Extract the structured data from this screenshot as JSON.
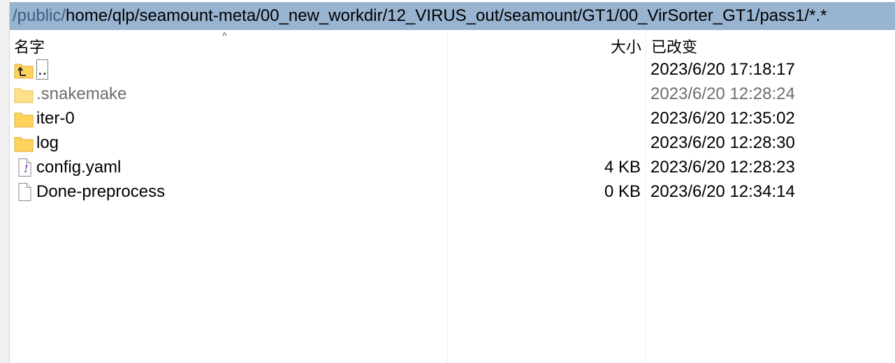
{
  "path_bar": {
    "prefix": "/public/",
    "rest": "home/qlp/seamount-meta/00_new_workdir/12_VIRUS_out/seamount/GT1/00_VirSorter_GT1/pass1/*.*"
  },
  "columns": {
    "name": "名字",
    "size": "大小",
    "date": "已改变"
  },
  "sort": {
    "column": "name",
    "arrow": "^"
  },
  "files": [
    {
      "icon": "parent-folder-icon",
      "name": "..",
      "size": "",
      "date": "2023/6/20 17:18:17",
      "hidden": false
    },
    {
      "icon": "folder-icon",
      "name": ".snakemake",
      "size": "",
      "date": "2023/6/20 12:28:24",
      "hidden": true
    },
    {
      "icon": "folder-icon",
      "name": "iter-0",
      "size": "",
      "date": "2023/6/20 12:35:02",
      "hidden": false
    },
    {
      "icon": "folder-icon",
      "name": "log",
      "size": "",
      "date": "2023/6/20 12:28:30",
      "hidden": false
    },
    {
      "icon": "yaml-file-icon",
      "name": "config.yaml",
      "size": "4 KB",
      "date": "2023/6/20 12:28:23",
      "hidden": false
    },
    {
      "icon": "file-icon",
      "name": "Done-preprocess",
      "size": "0 KB",
      "date": "2023/6/20 12:34:14",
      "hidden": false
    }
  ],
  "colors": {
    "path_bar_bg": "#99b4d1",
    "folder": "#ffd35c",
    "hidden_text": "#6d6d6d"
  }
}
